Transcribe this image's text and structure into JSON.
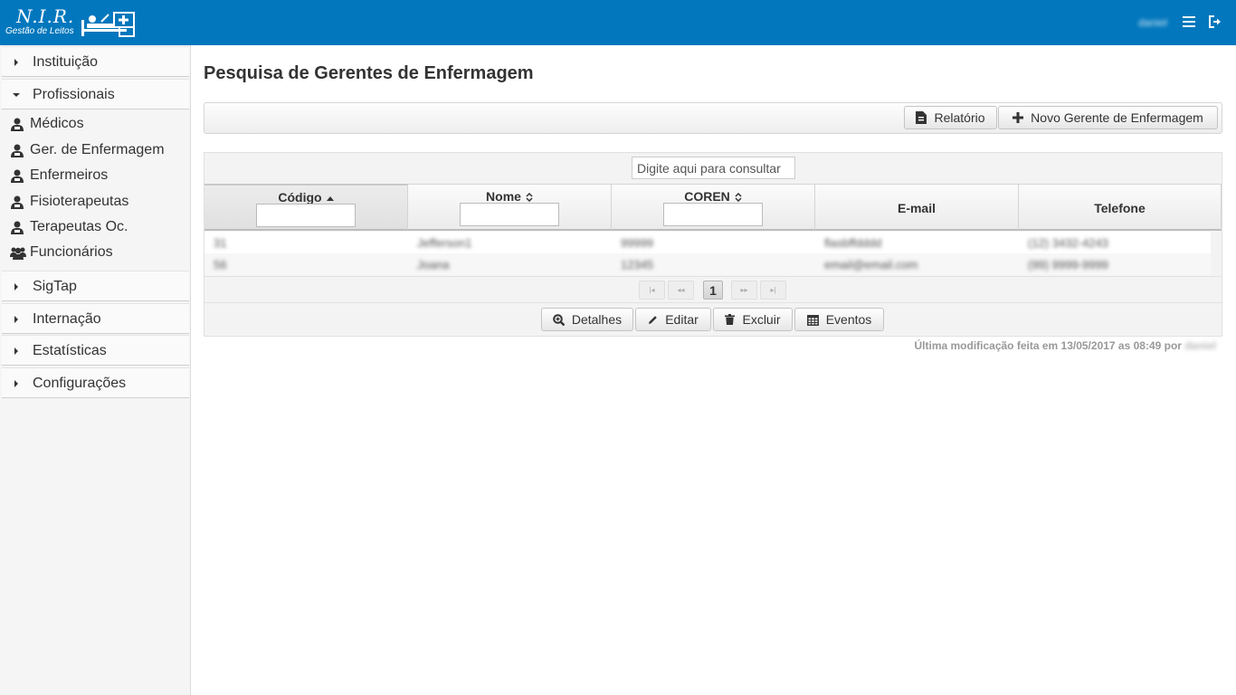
{
  "header": {
    "logo_title": "N.I.R.",
    "logo_subtitle": "Gestão de Leitos",
    "user": "daniel",
    "menu_icon": "hamburger-icon",
    "logout_icon": "sign-out-icon",
    "bar_color": "#0277bd"
  },
  "sidebar": {
    "sections": [
      {
        "label": "Instituição",
        "expanded": false
      },
      {
        "label": "Profissionais",
        "expanded": true
      },
      {
        "label": "SigTap",
        "expanded": false
      },
      {
        "label": "Internação",
        "expanded": false
      },
      {
        "label": "Estatísticas",
        "expanded": false
      },
      {
        "label": "Configurações",
        "expanded": false
      }
    ],
    "profissionais_items": [
      {
        "label": "Médicos",
        "icon": "user-md-icon"
      },
      {
        "label": "Ger. de Enfermagem",
        "icon": "user-md-icon"
      },
      {
        "label": "Enfermeiros",
        "icon": "user-md-icon"
      },
      {
        "label": "Fisioterapeutas",
        "icon": "user-md-icon"
      },
      {
        "label": "Terapeutas Oc.",
        "icon": "user-md-icon"
      },
      {
        "label": "Funcionários",
        "icon": "users-icon"
      }
    ]
  },
  "main": {
    "title": "Pesquisa de Gerentes de Enfermagem",
    "toolbar": {
      "report_label": "Relatório",
      "new_label": "Novo Gerente de Enfermagem"
    },
    "table": {
      "search_placeholder": "Digite aqui para consultar",
      "columns": [
        {
          "label": "Código",
          "sort": "ascending",
          "filter": true
        },
        {
          "label": "Nome",
          "sort": "sortable",
          "filter": true
        },
        {
          "label": "COREN",
          "sort": "sortable",
          "filter": true
        },
        {
          "label": "E-mail",
          "sort": "none",
          "filter": false
        },
        {
          "label": "Telefone",
          "sort": "none",
          "filter": false
        }
      ],
      "rows": [
        [
          "31",
          "Jefferson1",
          "99999",
          "flasbffdddd",
          "(12) 3432-4243"
        ],
        [
          "56",
          "Joana",
          "12345",
          "email@email.com",
          "(99) 9999-9999"
        ]
      ],
      "paginator": {
        "first": "first-page-icon",
        "prev": "prev-page-icon",
        "current_page": "1",
        "next": "next-page-icon",
        "last": "last-page-icon"
      },
      "actions": {
        "details": "Detalhes",
        "edit": "Editar",
        "delete": "Excluir",
        "events": "Eventos"
      }
    },
    "footer": {
      "last_modified": "Última modificação feita em 13/05/2017 as 08:49 por",
      "modified_by": "daniel"
    }
  }
}
